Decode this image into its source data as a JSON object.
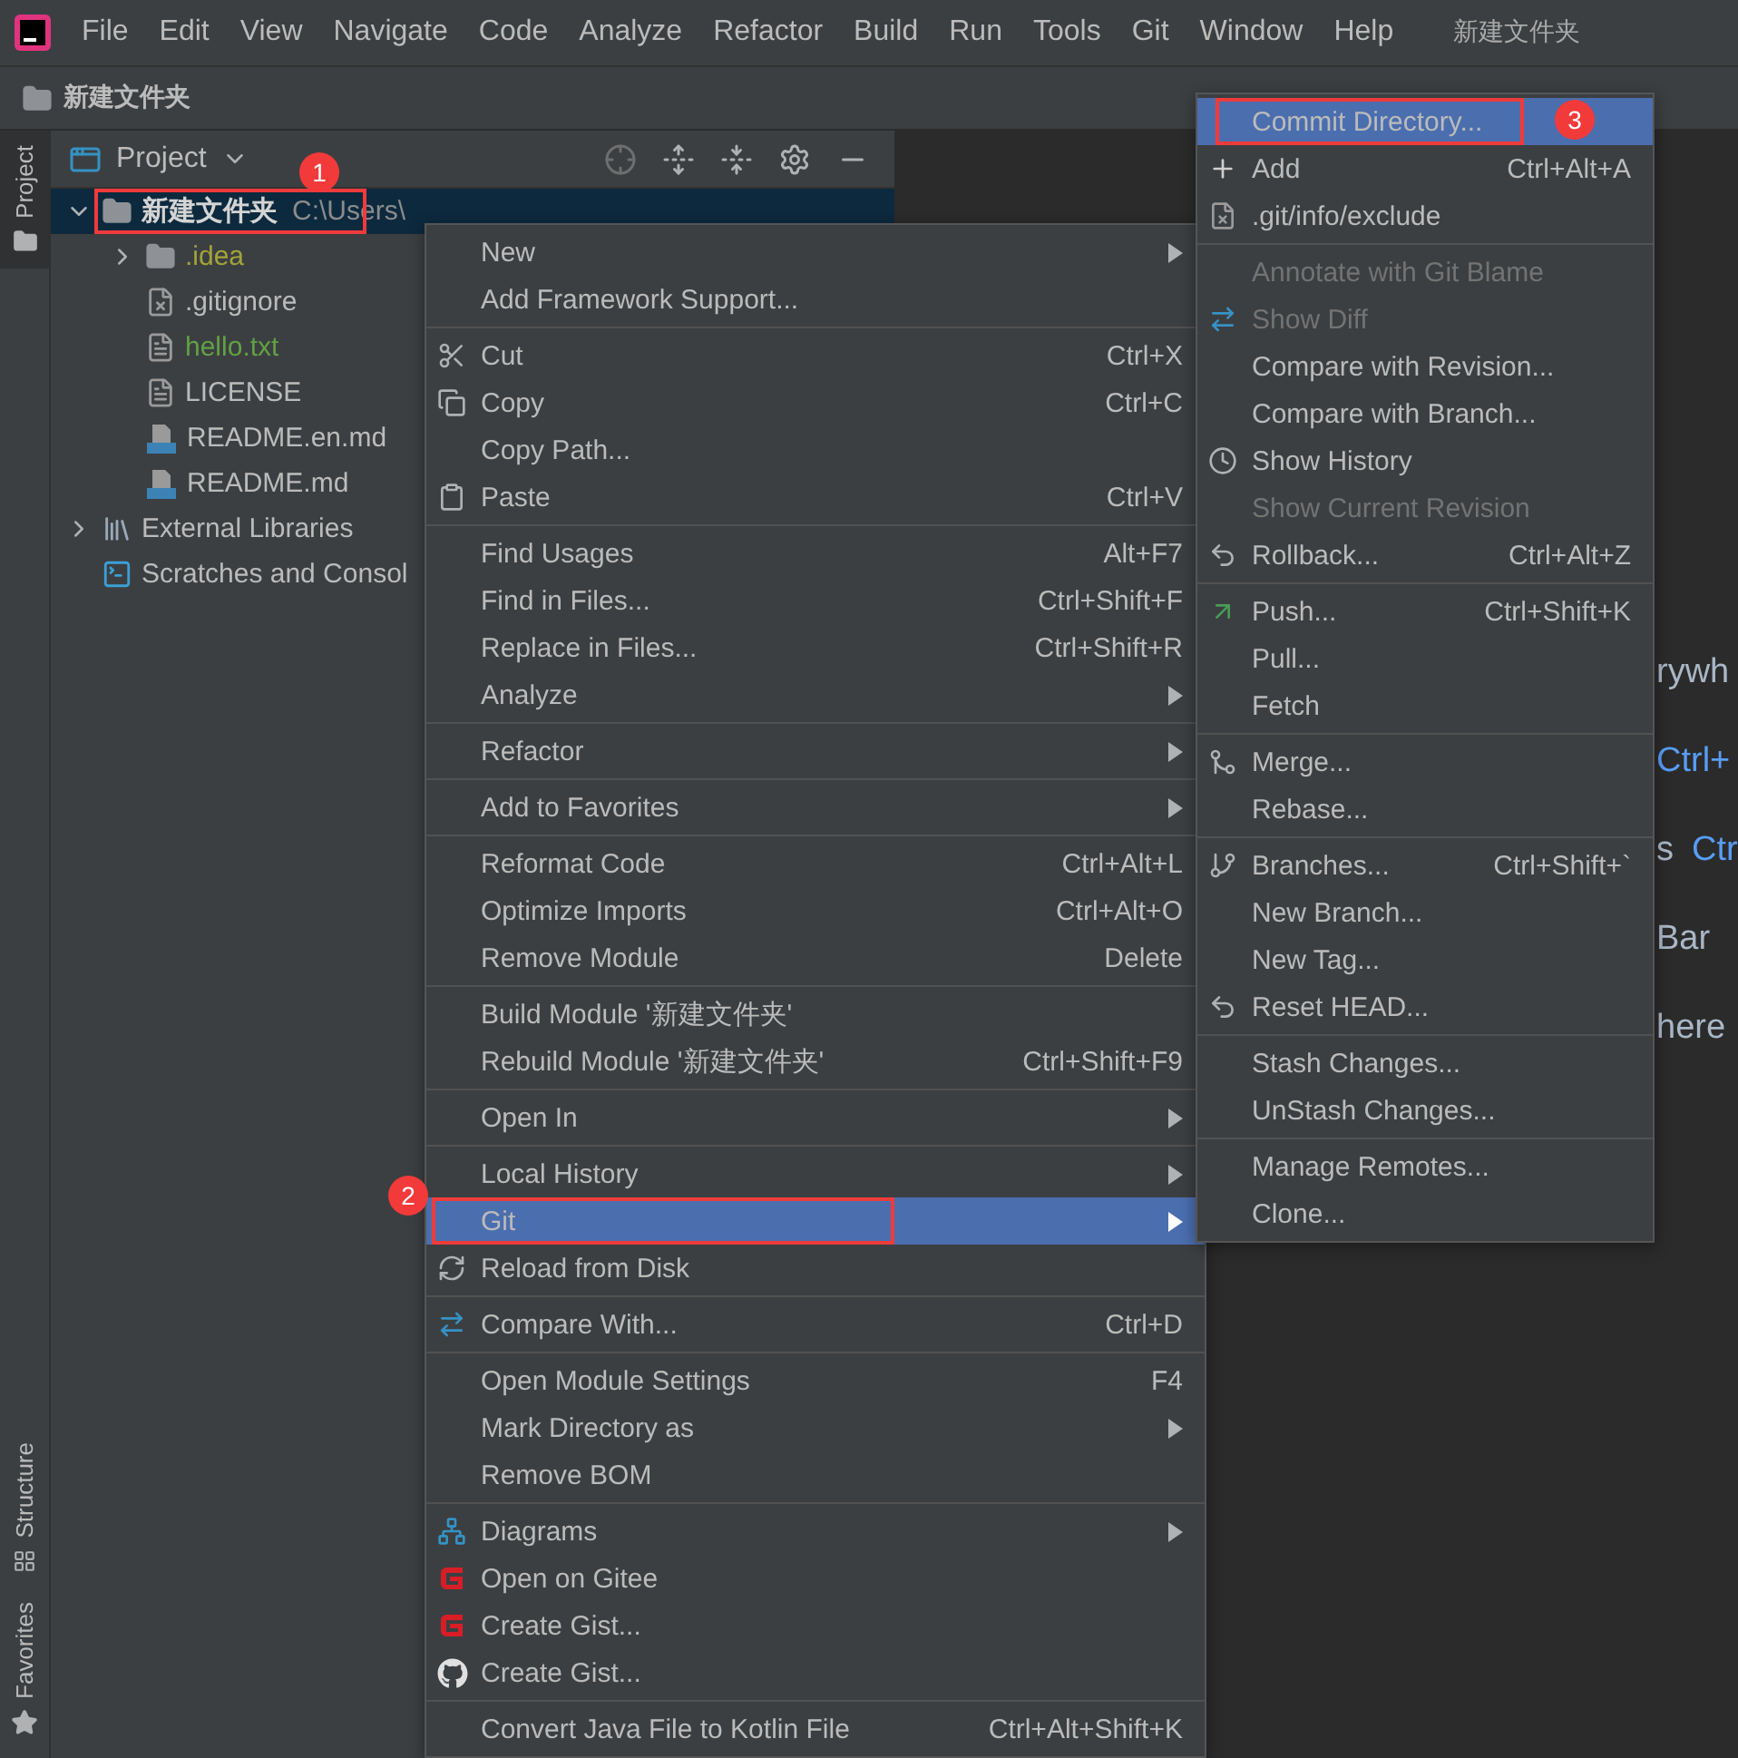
{
  "menu_bar": {
    "items": [
      "File",
      "Edit",
      "View",
      "Navigate",
      "Code",
      "Analyze",
      "Refactor",
      "Build",
      "Run",
      "Tools",
      "Git",
      "Window",
      "Help"
    ],
    "title": "新建文件夹"
  },
  "breadcrumb": {
    "label": "新建文件夹"
  },
  "side_strip": {
    "top": [
      {
        "label": "Project",
        "selected": true
      }
    ],
    "bottom": [
      {
        "label": "Structure",
        "kind": "structure"
      },
      {
        "label": "Favorites",
        "kind": "favorites"
      }
    ]
  },
  "project_panel": {
    "title": "Project",
    "tree": [
      {
        "label": "新建文件夹",
        "path": "C:\\Users\\",
        "kind": "module",
        "expanded": true,
        "selected": true,
        "boxed": true,
        "badge": "1",
        "color": "#d4d4d4",
        "children": [
          {
            "label": ".idea",
            "kind": "folder",
            "expanded": false,
            "selected": false,
            "color": "#a3a33a"
          },
          {
            "label": ".gitignore",
            "kind": "ignored",
            "selected": false,
            "color": "#bbbbbb"
          },
          {
            "label": "hello.txt",
            "kind": "text",
            "selected": false,
            "color": "#62a044"
          },
          {
            "label": "LICENSE",
            "kind": "text",
            "selected": false,
            "color": "#bbbbbb"
          },
          {
            "label": "README.en.md",
            "kind": "markdown",
            "selected": false,
            "color": "#bbbbbb"
          },
          {
            "label": "README.md",
            "kind": "markdown",
            "selected": false,
            "color": "#bbbbbb"
          }
        ]
      },
      {
        "label": "External Libraries",
        "kind": "libraries",
        "expanded": false,
        "selected": false,
        "color": "#bbbbbb"
      },
      {
        "label": "Scratches and Consol",
        "kind": "scratches",
        "selected": false,
        "color": "#bbbbbb"
      }
    ]
  },
  "editor_hints": [
    [
      {
        "text": "rywh",
        "kind": "text"
      }
    ],
    [
      {
        "text": "Ctrl+",
        "kind": "key"
      }
    ],
    [
      {
        "text": "s",
        "kind": "text"
      },
      {
        "text": "Ctr",
        "kind": "key"
      }
    ],
    [
      {
        "text": "Bar",
        "kind": "text"
      }
    ],
    [
      {
        "text": "here",
        "kind": "text"
      }
    ]
  ],
  "context_menu": {
    "groups": [
      [
        {
          "label": "New",
          "kind": "plain",
          "submenu": true
        },
        {
          "label": "Add Framework Support...",
          "kind": "plain"
        }
      ],
      [
        {
          "label": "Cut",
          "kind": "scissors",
          "shortcut": "Ctrl+X"
        },
        {
          "label": "Copy",
          "kind": "copy",
          "shortcut": "Ctrl+C"
        },
        {
          "label": "Copy Path...",
          "kind": "plain"
        },
        {
          "label": "Paste",
          "kind": "paste",
          "shortcut": "Ctrl+V"
        }
      ],
      [
        {
          "label": "Find Usages",
          "kind": "plain",
          "shortcut": "Alt+F7"
        },
        {
          "label": "Find in Files...",
          "kind": "plain",
          "shortcut": "Ctrl+Shift+F"
        },
        {
          "label": "Replace in Files...",
          "kind": "plain",
          "shortcut": "Ctrl+Shift+R"
        },
        {
          "label": "Analyze",
          "kind": "plain",
          "submenu": true
        }
      ],
      [
        {
          "label": "Refactor",
          "kind": "plain",
          "submenu": true
        }
      ],
      [
        {
          "label": "Add to Favorites",
          "kind": "plain",
          "submenu": true
        }
      ],
      [
        {
          "label": "Reformat Code",
          "kind": "plain",
          "shortcut": "Ctrl+Alt+L"
        },
        {
          "label": "Optimize Imports",
          "kind": "plain",
          "shortcut": "Ctrl+Alt+O"
        },
        {
          "label": "Remove Module",
          "kind": "plain",
          "shortcut": "Delete"
        }
      ],
      [
        {
          "label": "Build Module '新建文件夹'",
          "kind": "plain"
        },
        {
          "label": "Rebuild Module '新建文件夹'",
          "kind": "plain",
          "shortcut": "Ctrl+Shift+F9"
        }
      ],
      [
        {
          "label": "Open In",
          "kind": "plain",
          "submenu": true
        }
      ],
      [
        {
          "label": "Local History",
          "kind": "plain",
          "submenu": true
        },
        {
          "label": "Git",
          "kind": "plain",
          "submenu": true,
          "selected": true,
          "boxed": true,
          "badge": "2"
        },
        {
          "label": "Reload from Disk",
          "kind": "reload"
        }
      ],
      [
        {
          "label": "Compare With...",
          "kind": "compare",
          "shortcut": "Ctrl+D"
        }
      ],
      [
        {
          "label": "Open Module Settings",
          "kind": "plain",
          "shortcut": "F4"
        },
        {
          "label": "Mark Directory as",
          "kind": "plain",
          "submenu": true
        },
        {
          "label": "Remove BOM",
          "kind": "plain"
        }
      ],
      [
        {
          "label": "Diagrams",
          "kind": "diagrams",
          "submenu": true
        },
        {
          "label": "Open on Gitee",
          "kind": "gitee"
        },
        {
          "label": "Create Gist...",
          "kind": "gitee"
        },
        {
          "label": "Create Gist...",
          "kind": "github"
        }
      ],
      [
        {
          "label": "Convert Java File to Kotlin File",
          "kind": "plain",
          "shortcut": "Ctrl+Alt+Shift+K"
        }
      ]
    ]
  },
  "git_menu": {
    "groups": [
      [
        {
          "label": "Commit Directory...",
          "kind": "plain",
          "selected": true,
          "boxed": true,
          "badge": "3"
        },
        {
          "label": "Add",
          "kind": "plus",
          "shortcut": "Ctrl+Alt+A"
        },
        {
          "label": ".git/info/exclude",
          "kind": "ignored"
        }
      ],
      [
        {
          "label": "Annotate with Git Blame",
          "kind": "plain",
          "disabled": true
        },
        {
          "label": "Show Diff",
          "kind": "compare",
          "disabled": true
        },
        {
          "label": "Compare with Revision...",
          "kind": "plain"
        },
        {
          "label": "Compare with Branch...",
          "kind": "plain"
        },
        {
          "label": "Show History",
          "kind": "clock"
        },
        {
          "label": "Show Current Revision",
          "kind": "plain",
          "disabled": true
        },
        {
          "label": "Rollback...",
          "kind": "undo",
          "shortcut": "Ctrl+Alt+Z"
        }
      ],
      [
        {
          "label": "Push...",
          "kind": "push",
          "shortcut": "Ctrl+Shift+K"
        },
        {
          "label": "Pull...",
          "kind": "plain"
        },
        {
          "label": "Fetch",
          "kind": "plain"
        }
      ],
      [
        {
          "label": "Merge...",
          "kind": "merge"
        },
        {
          "label": "Rebase...",
          "kind": "plain"
        }
      ],
      [
        {
          "label": "Branches...",
          "kind": "branch",
          "shortcut": "Ctrl+Shift+`"
        },
        {
          "label": "New Branch...",
          "kind": "plain"
        },
        {
          "label": "New Tag...",
          "kind": "plain"
        },
        {
          "label": "Reset HEAD...",
          "kind": "undo"
        }
      ],
      [
        {
          "label": "Stash Changes...",
          "kind": "plain"
        },
        {
          "label": "UnStash Changes...",
          "kind": "plain"
        }
      ],
      [
        {
          "label": "Manage Remotes...",
          "kind": "plain"
        },
        {
          "label": "Clone...",
          "kind": "plain"
        }
      ]
    ]
  }
}
